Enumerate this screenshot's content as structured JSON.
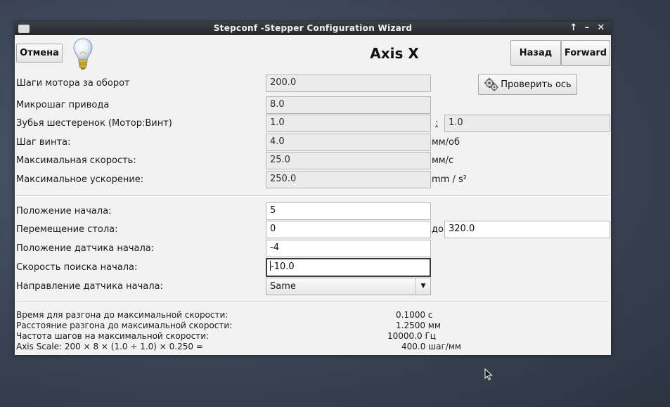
{
  "window": {
    "title": "Stepconf -Stepper Configuration Wizard",
    "controls": {
      "maximize": "↑",
      "minimize": "–",
      "close": "✕"
    }
  },
  "toolbar": {
    "cancel_label": "Отмена",
    "page_title": "Axis X",
    "back_label": "Назад",
    "forward_label": "Forward"
  },
  "motor": {
    "steps_label": "Шаги мотора за оборот",
    "steps_value": "200.0",
    "microstep_label": "Микрошаг привода",
    "microstep_value": "8.0",
    "gear_label": "Зубья шестеренок (Мотор:Винт)",
    "gear_motor_value": "1.0",
    "gear_separator": ":",
    "gear_screw_value": "1.0",
    "pitch_label": "Шаг винта:",
    "pitch_value": "4.0",
    "pitch_unit": "мм/об",
    "maxvel_label": "Максимальная скорость:",
    "maxvel_value": "25.0",
    "maxvel_unit": "мм/с",
    "maxacc_label": "Максимальное ускорение:",
    "maxacc_value": "250.0",
    "maxacc_unit": "mm / s²",
    "test_button_label": "Проверить ось"
  },
  "homing": {
    "home_label": "Положение начала:",
    "home_value": "5",
    "travel_label": "Перемещение стола:",
    "travel_min_value": "0",
    "travel_to": "до",
    "travel_max_value": "320.0",
    "switch_label": "Положение датчика начала:",
    "switch_value": "-4",
    "search_vel_label": "Скорость поиска начала:",
    "search_vel_value": "-10.0",
    "direction_label": "Направление датчика начала:",
    "direction_value": "Same"
  },
  "info": {
    "accel_time_label": "Время для разгона до максимальной скорости:",
    "accel_time_value": "0.1000 с",
    "accel_dist_label": "Расстояние разгона до максимальной скорости:",
    "accel_dist_value": "1.2500 мм",
    "step_rate_label": "Частота шагов на максимальной скорости:",
    "step_rate_value": "10000.0 Гц",
    "scale_label": "Axis Scale: 200 × 8 × (1.0 ÷ 1.0) × 0.250 =",
    "scale_value": "400.0 шаг/мм"
  },
  "colors": {
    "titlebar": "#2e3035",
    "dialog_bg": "#f2f2f2",
    "desktop": "#3a4454"
  }
}
